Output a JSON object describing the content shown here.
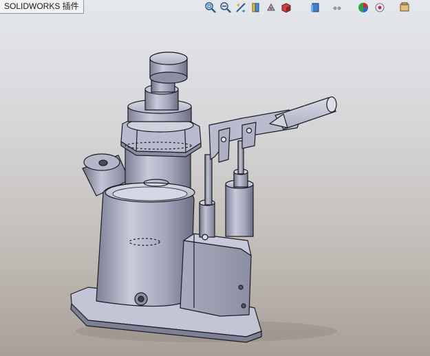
{
  "app": {
    "tab_label": "SOLIDWORKS 插件"
  },
  "toolbar": {
    "buttons": [
      {
        "name": "zoom-to-fit-icon"
      },
      {
        "name": "zoom-to-area-icon"
      },
      {
        "name": "previous-view-icon"
      },
      {
        "name": "section-view-icon"
      },
      {
        "name": "view-orientation-icon"
      },
      {
        "name": "display-style-icon"
      },
      {
        "name": "hide-show-items-icon"
      },
      {
        "name": "edit-appearance-icon"
      },
      {
        "name": "apply-scene-icon"
      },
      {
        "name": "view-settings-icon"
      }
    ]
  },
  "colors": {
    "background_top": "#e4e7ec",
    "background_bottom": "#a89f98",
    "part_light": "#c8cadb",
    "part_mid": "#9597ad",
    "part_dark": "#5d5f73",
    "edge": "#1c1c22"
  }
}
